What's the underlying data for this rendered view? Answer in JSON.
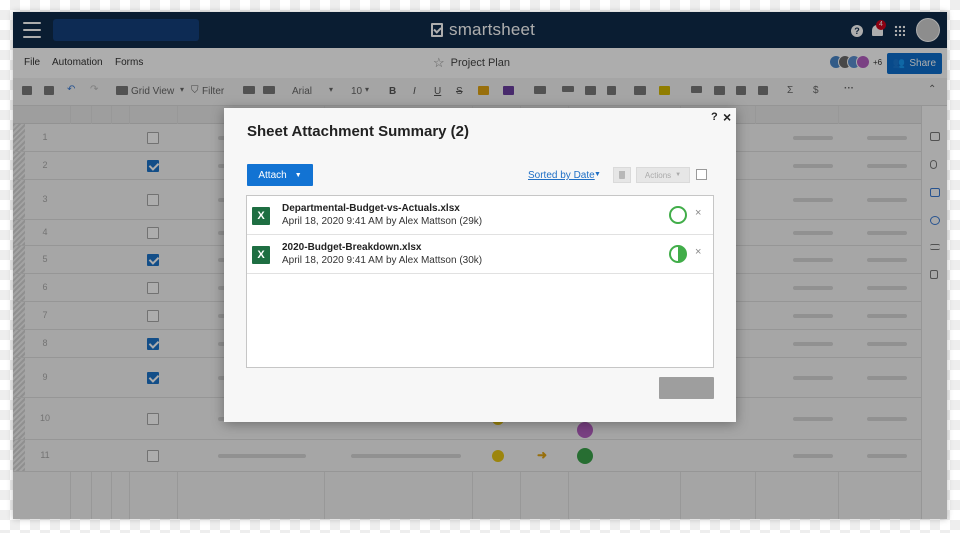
{
  "brand": {
    "name": "smartsheet"
  },
  "notifications": {
    "count": "4"
  },
  "menu": {
    "file": "File",
    "automation": "Automation",
    "forms": "Forms"
  },
  "sheet": {
    "title": "Project Plan"
  },
  "collaborators": {
    "more": "+6"
  },
  "share": {
    "label": "Share"
  },
  "toolbar": {
    "grid_view": "Grid View",
    "filter": "Filter",
    "font": "Arial",
    "font_size": "10",
    "bold": "B",
    "italic": "I",
    "underline": "U",
    "strike": "S"
  },
  "grid": {
    "rows": [
      {
        "num": "1",
        "checked": false
      },
      {
        "num": "2",
        "checked": true
      },
      {
        "num": "3",
        "checked": false
      },
      {
        "num": "4",
        "checked": false
      },
      {
        "num": "5",
        "checked": true
      },
      {
        "num": "6",
        "checked": false
      },
      {
        "num": "7",
        "checked": false
      },
      {
        "num": "8",
        "checked": true
      },
      {
        "num": "9",
        "checked": true
      },
      {
        "num": "10",
        "checked": false
      },
      {
        "num": "11",
        "checked": false
      }
    ]
  },
  "dialog": {
    "title": "Sheet Attachment Summary (2)",
    "help": "?",
    "close": "×",
    "attach_label": "Attach",
    "sort_label": "Sorted by Date",
    "actions_label": "Actions",
    "files": [
      {
        "icon": "X",
        "name": "Departmental-Budget-vs-Actuals.xlsx",
        "meta": "April 18, 2020 9:41 AM by Alex Mattson (29k)",
        "status": "empty"
      },
      {
        "icon": "X",
        "name": "2020-Budget-Breakdown.xlsx",
        "meta": "April 18, 2020 9:41 AM by Alex Mattson (30k)",
        "status": "half"
      }
    ]
  },
  "colors": {
    "navy": "#0f2c4b",
    "accent": "#1273d3",
    "excel": "#1e6e42",
    "status_green": "#41ad49"
  }
}
